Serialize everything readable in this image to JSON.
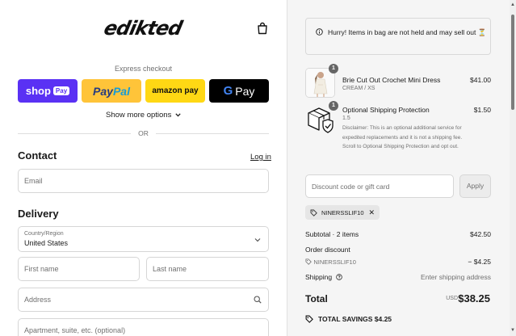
{
  "brand": {
    "logo_text": "edikted"
  },
  "express": {
    "label": "Express checkout",
    "shop_label": "shop",
    "shop_badge": "Pay",
    "paypal_a": "Pay",
    "paypal_b": "Pal",
    "amazon_label": "amazon pay",
    "gpay_g": "G",
    "gpay_label": "Pay",
    "show_more": "Show more options",
    "or": "OR"
  },
  "contact": {
    "title": "Contact",
    "login": "Log in",
    "email_placeholder": "Email"
  },
  "delivery": {
    "title": "Delivery",
    "country_label": "Country/Region",
    "country_value": "United States",
    "first_name": "First name",
    "last_name": "Last name",
    "address": "Address",
    "apartment": "Apartment, suite, etc. (optional)"
  },
  "notice": {
    "text": "Hurry! Items in bag are not held and may sell out ⏳"
  },
  "items": [
    {
      "name": "Brie Cut Out Crochet Mini Dress",
      "variant": "CREAM / XS",
      "price": "$41.00",
      "qty": "1"
    },
    {
      "name": "Optional Shipping Protection",
      "variant": "1.5",
      "price": "$1.50",
      "qty": "1",
      "disclaimer": "Disclaimer: This is an optional additional service for expedited replacements and it is not a shipping fee. Scroll to Optional Shipping Protection and opt out."
    }
  ],
  "discount": {
    "placeholder": "Discount code or gift card",
    "apply": "Apply",
    "code": "NINERSSLIF10",
    "remove": "✕"
  },
  "summary": {
    "subtotal_label": "Subtotal · 2 items",
    "subtotal_value": "$42.50",
    "order_discount_label": "Order discount",
    "discount_code": "NINERSSLIF10",
    "discount_value": "− $4.25",
    "shipping_label": "Shipping",
    "shipping_value": "Enter shipping address",
    "total_label": "Total",
    "currency": "USD",
    "total_value": "$38.25",
    "savings_label": "TOTAL SAVINGS",
    "savings_value": "$4.25"
  },
  "colors": {
    "shop_pay": "#5a31f4",
    "paypal": "#ffc439",
    "amazon": "#ffd814",
    "gpay": "#000000"
  }
}
